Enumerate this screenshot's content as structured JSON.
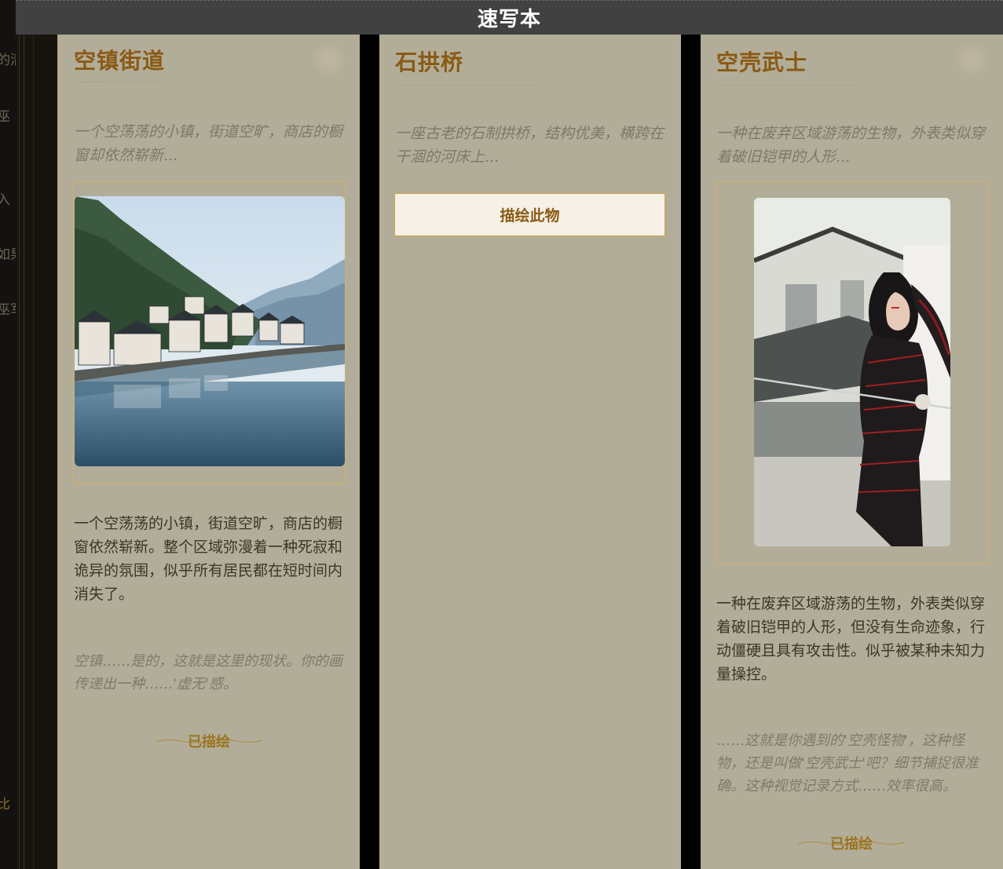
{
  "window": {
    "title": "速写本"
  },
  "backdrop": {
    "fragments": [
      "的清",
      "巫",
      "入",
      "如果",
      "巫军",
      "比"
    ]
  },
  "cards": [
    {
      "title": "空镇街道",
      "brief": "一个空荡荡的小镇，街道空旷，商店的橱窗却依然崭新...",
      "image_alt": "lakeside-town-illustration",
      "description": "一个空荡荡的小镇，街道空旷，商店的橱窗依然崭新。整个区域弥漫着一种死寂和诡异的氛围，似乎所有居民都在短时间内消失了。",
      "comment": "空镇……是的，这就是这里的现状。你的画传递出一种……'虚无'感。",
      "status": "已描绘"
    },
    {
      "title": "石拱桥",
      "brief": "一座古老的石制拱桥，结构优美，横跨在干涸的河床上...",
      "action": "描绘此物"
    },
    {
      "title": "空壳武士",
      "brief": "一种在废弃区域游荡的生物，外表类似穿着破旧铠甲的人形...",
      "image_alt": "armored-warrior-illustration",
      "description": "一种在废弃区域游荡的生物，外表类似穿着破旧铠甲的人形，但没有生命迹象，行动僵硬且具有攻击性。似乎被某种未知力量操控。",
      "comment": "……这就是你遇到的'空壳怪物'，这种怪物，还是叫做'空壳武士'吧？细节捕捉很准确。这种视觉记录方式……效率很高。",
      "status": "已描绘"
    }
  ],
  "colors": {
    "card_bg": "#b2ad99",
    "title": "#8a5a14",
    "accent_gold": "#c9a75c",
    "titlebar": "#414141"
  }
}
